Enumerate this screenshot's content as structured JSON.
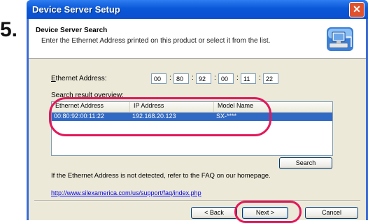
{
  "step_number": "5.",
  "window": {
    "title": "Device Server Setup",
    "close_glyph": "✕"
  },
  "header": {
    "title": "Device Server Search",
    "subtitle": "Enter the Ethernet Address printed on this product or select it from the list.",
    "icon": "computer-network-icon"
  },
  "ethernet": {
    "label": "Ethernet Address:",
    "octets": [
      "00",
      "80",
      "92",
      "00",
      "11",
      "22"
    ],
    "separator": ":"
  },
  "results": {
    "label": "Search result overview:",
    "columns": [
      "Ethernet Address",
      "IP Address",
      "Model Name"
    ],
    "rows": [
      {
        "ethernet": "00:80:92:00:11:22",
        "ip": "192.168.20.123",
        "model": "SX-****"
      }
    ]
  },
  "search_button": "Search",
  "help_text": "If the Ethernet Address is not detected, refer to the FAQ on our homepage.",
  "faq_link": "http://www.silexamerica.com/us/support/faq/index.php",
  "buttons": {
    "back": "< Back",
    "next": "Next >",
    "cancel": "Cancel"
  },
  "colors": {
    "annotation": "#e3185a",
    "selection": "#316ac5",
    "title_bar": "#0a58d8"
  }
}
